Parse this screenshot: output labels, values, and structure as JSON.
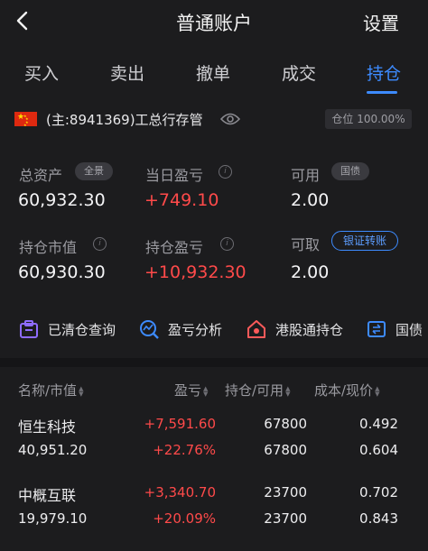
{
  "header": {
    "title": "普通账户",
    "settings_label": "设置"
  },
  "tabs": [
    {
      "label": "买入"
    },
    {
      "label": "卖出"
    },
    {
      "label": "撤单"
    },
    {
      "label": "成交"
    },
    {
      "label": "持仓",
      "active": true
    }
  ],
  "account": {
    "name": "(主:8941369)工总行存管",
    "position_ratio": "仓位 100.00%"
  },
  "summary": {
    "total_assets_label": "总资产",
    "total_assets_chip": "全景",
    "total_assets_value": "60,932.30",
    "daily_pnl_label": "当日盈亏",
    "daily_pnl_value": "+749.10",
    "available_label": "可用",
    "available_chip": "国债",
    "available_value": "2.00",
    "market_value_label": "持仓市值",
    "market_value_value": "60,930.30",
    "position_pnl_label": "持仓盈亏",
    "position_pnl_value": "+10,932.30",
    "withdrawable_label": "可取",
    "transfer_button": "银证转账",
    "withdrawable_value": "2.00"
  },
  "shortcuts": [
    {
      "label": "已清仓查询",
      "icon": "cleared-positions-icon"
    },
    {
      "label": "盈亏分析",
      "icon": "pnl-analysis-icon"
    },
    {
      "label": "港股通持仓",
      "icon": "hk-connect-icon"
    },
    {
      "label": "国债",
      "icon": "treasury-icon"
    }
  ],
  "table": {
    "headers": [
      "名称/市值",
      "盈亏",
      "持仓/可用",
      "成本/现价"
    ],
    "rows": [
      {
        "name": "恒生科技",
        "market_value": "40,951.20",
        "pnl": "+7,591.60",
        "pnl_pct": "+22.76%",
        "holding": "67800",
        "available": "67800",
        "cost": "0.492",
        "price": "0.604"
      },
      {
        "name": "中概互联",
        "market_value": "19,979.10",
        "pnl": "+3,340.70",
        "pnl_pct": "+20.09%",
        "holding": "23700",
        "available": "23700",
        "cost": "0.702",
        "price": "0.843"
      }
    ]
  },
  "colors": {
    "background": "#1c1c1e",
    "accent": "#3d8bff",
    "profit": "#ff4a4a"
  }
}
